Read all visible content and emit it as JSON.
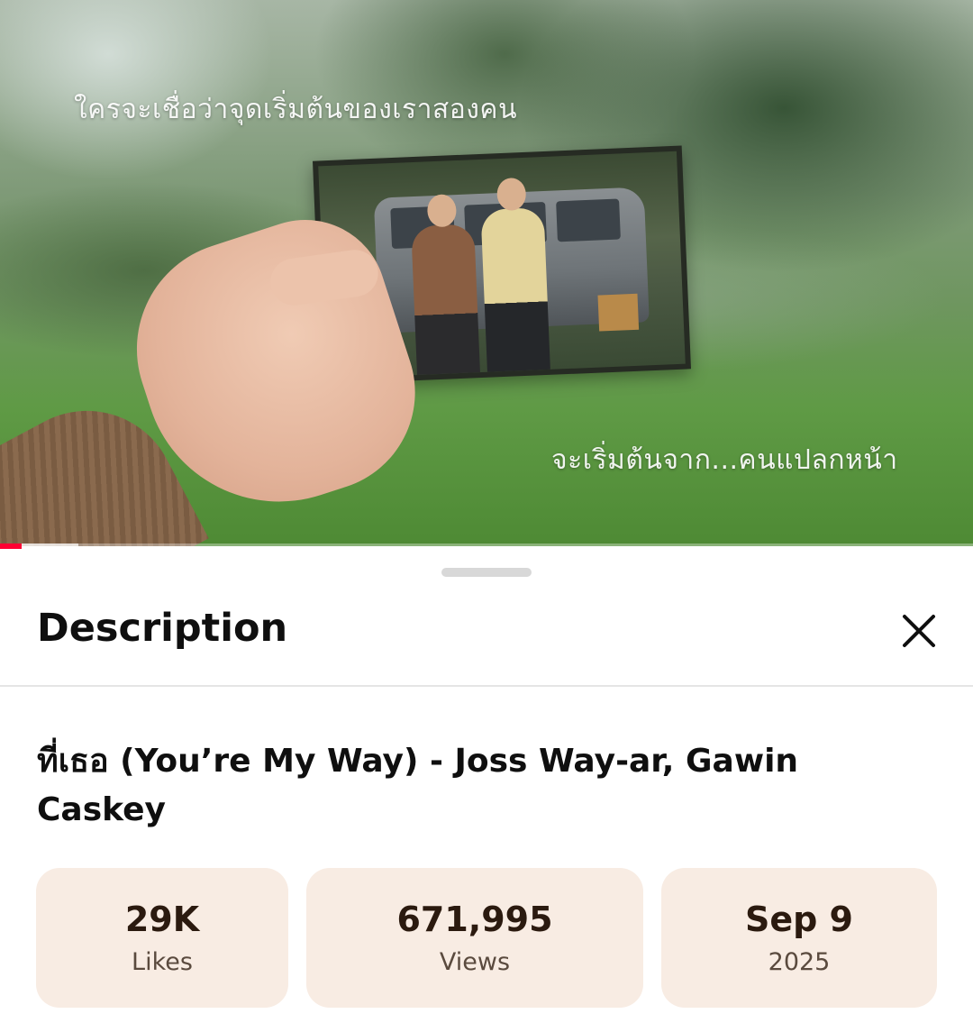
{
  "video": {
    "subtitle_top": "ใครจะเชื่อว่าจุดเริ่มต้นของเราสองคน",
    "subtitle_bottom": "จะเริ่มต้นจาก...คนแปลกหน้า",
    "progress_played_fraction": 0.022,
    "progress_buffered_fraction": 0.081
  },
  "sheet": {
    "title": "Description",
    "close_icon": "close-icon",
    "video_title": "ที่เธอ (You’re My Way) - Joss Way-ar, Gawin Caskey",
    "stats": {
      "likes": {
        "value": "29K",
        "label": "Likes"
      },
      "views": {
        "value": "671,995",
        "label": "Views"
      },
      "date": {
        "value": "Sep 9",
        "label": "2025"
      }
    }
  },
  "colors": {
    "progress_played": "#ff0033",
    "stat_background": "#f8ece3",
    "stat_value": "#2b1a0f"
  }
}
